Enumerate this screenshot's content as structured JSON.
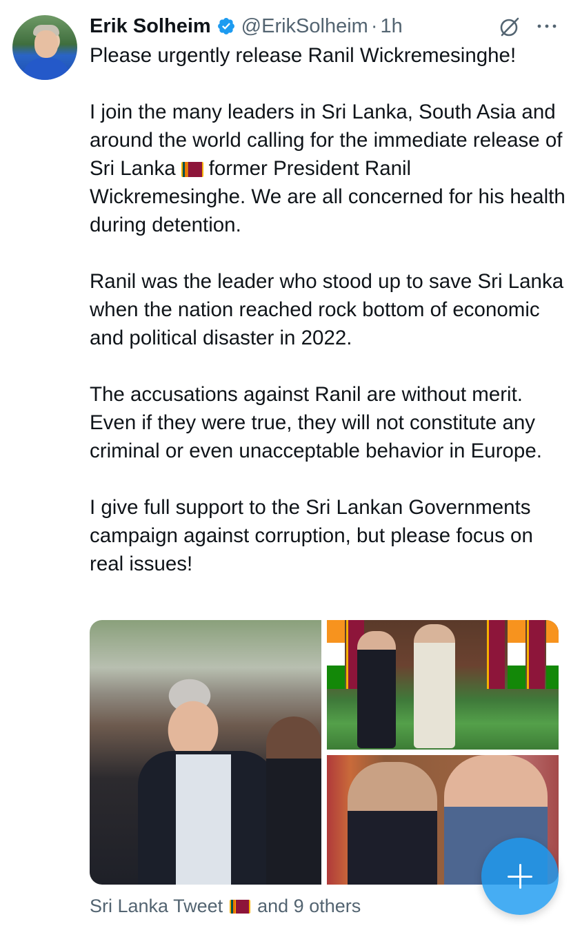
{
  "tweet": {
    "author_name": "Erik Solheim",
    "handle": "@ErikSolheim",
    "separator": "·",
    "time": "1h",
    "verified": true,
    "paragraphs": [
      "Please urgently release Ranil Wickremesinghe!",
      "I join the many leaders in Sri Lanka, South Asia and around the world calling for the immediate release of Sri Lanka",
      "former President Ranil Wickremesinghe. We are all concerned for his health during detention.",
      "Ranil was the leader who stood up to save Sri Lanka when the nation reached rock bottom of economic and political disaster in 2022.",
      "The accusations against Ranil are without merit. Even if they were true, they will not constitute any criminal or even unacceptable behavior in Europe.",
      "I give full support to the Sri Lankan Governments campaign against corruption, but please focus on real issues!"
    ],
    "media_count": 3,
    "footer_text_before": "Sri Lanka Tweet",
    "footer_text_after": "and 9 others"
  },
  "icons": {
    "verified": "verified-badge-icon",
    "grok": "grok-icon",
    "more": "more-icon",
    "compose": "plus-icon",
    "flag": "sri-lanka-flag-emoji"
  },
  "colors": {
    "text_primary": "#0f1419",
    "text_secondary": "#536471",
    "accent": "#1d9bf0"
  }
}
